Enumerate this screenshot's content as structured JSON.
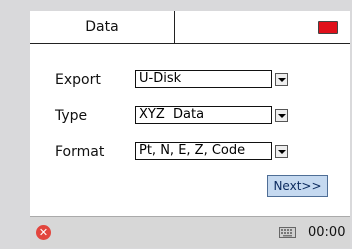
{
  "tab": {
    "label": "Data"
  },
  "form": {
    "export_label": "Export",
    "export_value": "U-Disk",
    "type_label": "Type",
    "type_value": "XYZ  Data",
    "format_label": "Format",
    "format_value": "Pt, N, E, Z, Code"
  },
  "next_label": "Next>>",
  "status": {
    "time": "00:00"
  },
  "icons": {
    "battery": "battery-icon",
    "close": "close-icon",
    "keyboard": "keyboard-icon",
    "dropdown": "chevron-down-icon"
  },
  "colors": {
    "battery": "#e0101a",
    "close": "#e2453d",
    "next_button": "#c5d9f0"
  }
}
